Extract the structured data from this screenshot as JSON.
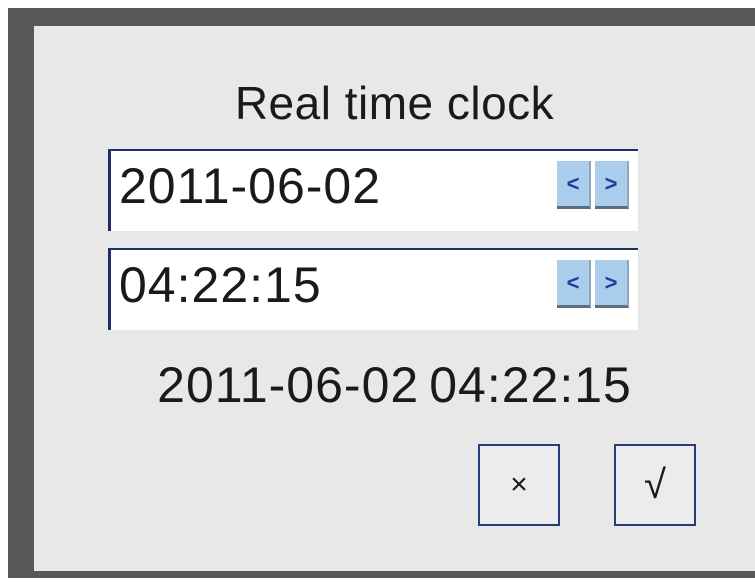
{
  "dialog": {
    "title": "Real time clock",
    "date": {
      "value": "2011-06-02",
      "decrement_label": "<",
      "increment_label": ">"
    },
    "time": {
      "value": "04:22:15",
      "decrement_label": "<",
      "increment_label": ">"
    },
    "summary": {
      "date": "2011-06-02",
      "time": "04:22:15"
    },
    "buttons": {
      "cancel_label": "×",
      "ok_label": "√"
    }
  },
  "colors": {
    "frame": "#585858",
    "panel": "#e8e8e8",
    "field_border": "#1f2d6b",
    "spin_button": "#a9cdea",
    "text": "#1a1a1a"
  }
}
